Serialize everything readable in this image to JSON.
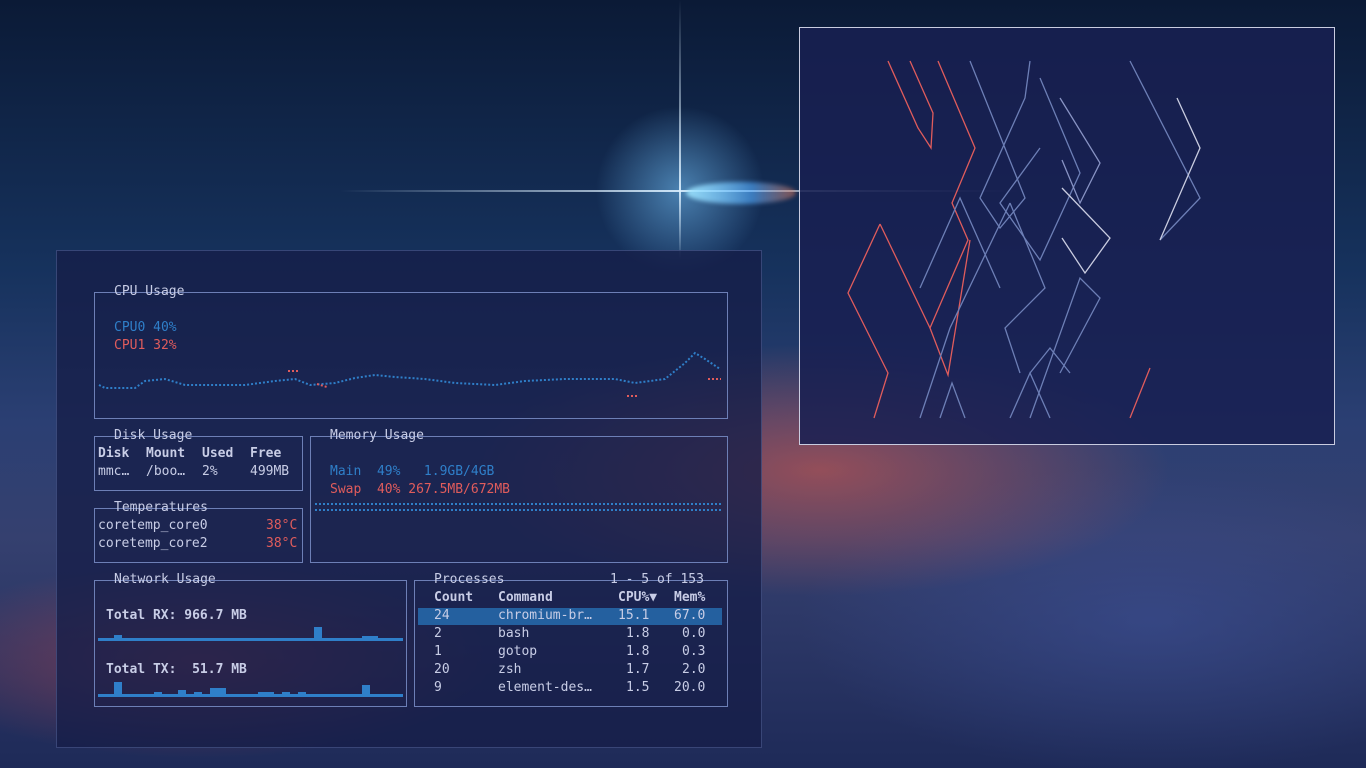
{
  "cpu": {
    "title": "CPU Usage",
    "cpu0": "CPU0 40%",
    "cpu1": "CPU1 32%"
  },
  "disk": {
    "title": "Disk Usage",
    "headers": [
      "Disk",
      "Mount",
      "Used",
      "Free"
    ],
    "row": [
      "mmc…",
      "/boo…",
      "2%",
      "499MB"
    ]
  },
  "memory": {
    "title": "Memory Usage",
    "main": "Main  49%   1.9GB/4GB",
    "swap": "Swap  40% 267.5MB/672MB"
  },
  "temps": {
    "title": "Temperatures",
    "items": [
      {
        "name": "coretemp_core0",
        "value": "38°C"
      },
      {
        "name": "coretemp_core2",
        "value": "38°C"
      }
    ]
  },
  "network": {
    "title": "Network Usage",
    "rx": "Total RX: 966.7 MB",
    "tx": "Total TX:  51.7 MB"
  },
  "processes": {
    "title": "Processes",
    "range": "1 - 5 of 153",
    "headers": [
      "Count",
      "Command",
      "CPU%▼",
      "Mem%"
    ],
    "rows": [
      [
        "24",
        "chromium-br…",
        "15.1",
        "67.0"
      ],
      [
        "2",
        "bash",
        "1.8",
        "0.0"
      ],
      [
        "1",
        "gotop",
        "1.8",
        "0.3"
      ],
      [
        "20",
        "zsh",
        "1.7",
        "2.0"
      ],
      [
        "9",
        "element-des…",
        "1.5",
        "20.0"
      ]
    ]
  },
  "colors": {
    "accent_blue": "#2f7fc9",
    "accent_red": "#e05c5c",
    "border": "#6d7fb6",
    "selection": "#24609f"
  }
}
